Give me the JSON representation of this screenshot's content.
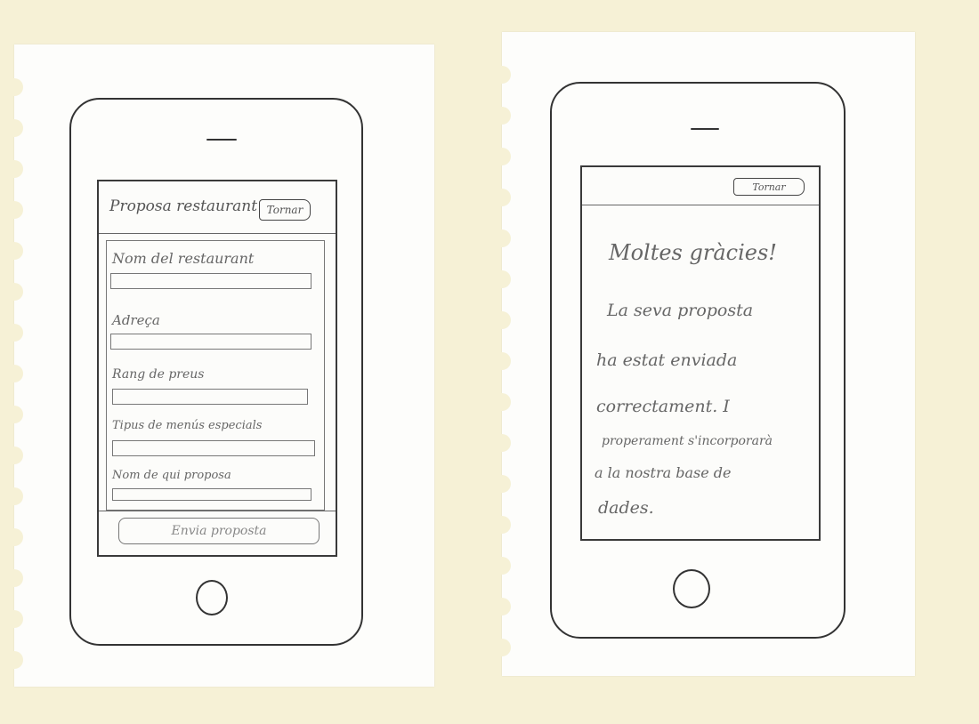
{
  "form_screen": {
    "title": "Proposa restaurant",
    "back_label": "Tornar",
    "fields": [
      {
        "label": "Nom del restaurant",
        "value": ""
      },
      {
        "label": "Adreça",
        "value": ""
      },
      {
        "label": "Rang de preus",
        "value": ""
      },
      {
        "label": "Tipus de menús especials",
        "value": ""
      },
      {
        "label": "Nom de qui proposa",
        "value": ""
      }
    ],
    "submit_label": "Envia proposta"
  },
  "thanks_screen": {
    "back_label": "Tornar",
    "heading": "Moltes gràcies!",
    "message_lines": [
      "La seva proposta",
      "ha estat enviada",
      "correctament. I",
      "properament s'incorporarà",
      "a la nostra base de",
      "dades."
    ]
  },
  "colors": {
    "background": "#f6f1d6",
    "paper": "#fdfdfb",
    "pencil": "#555555"
  }
}
